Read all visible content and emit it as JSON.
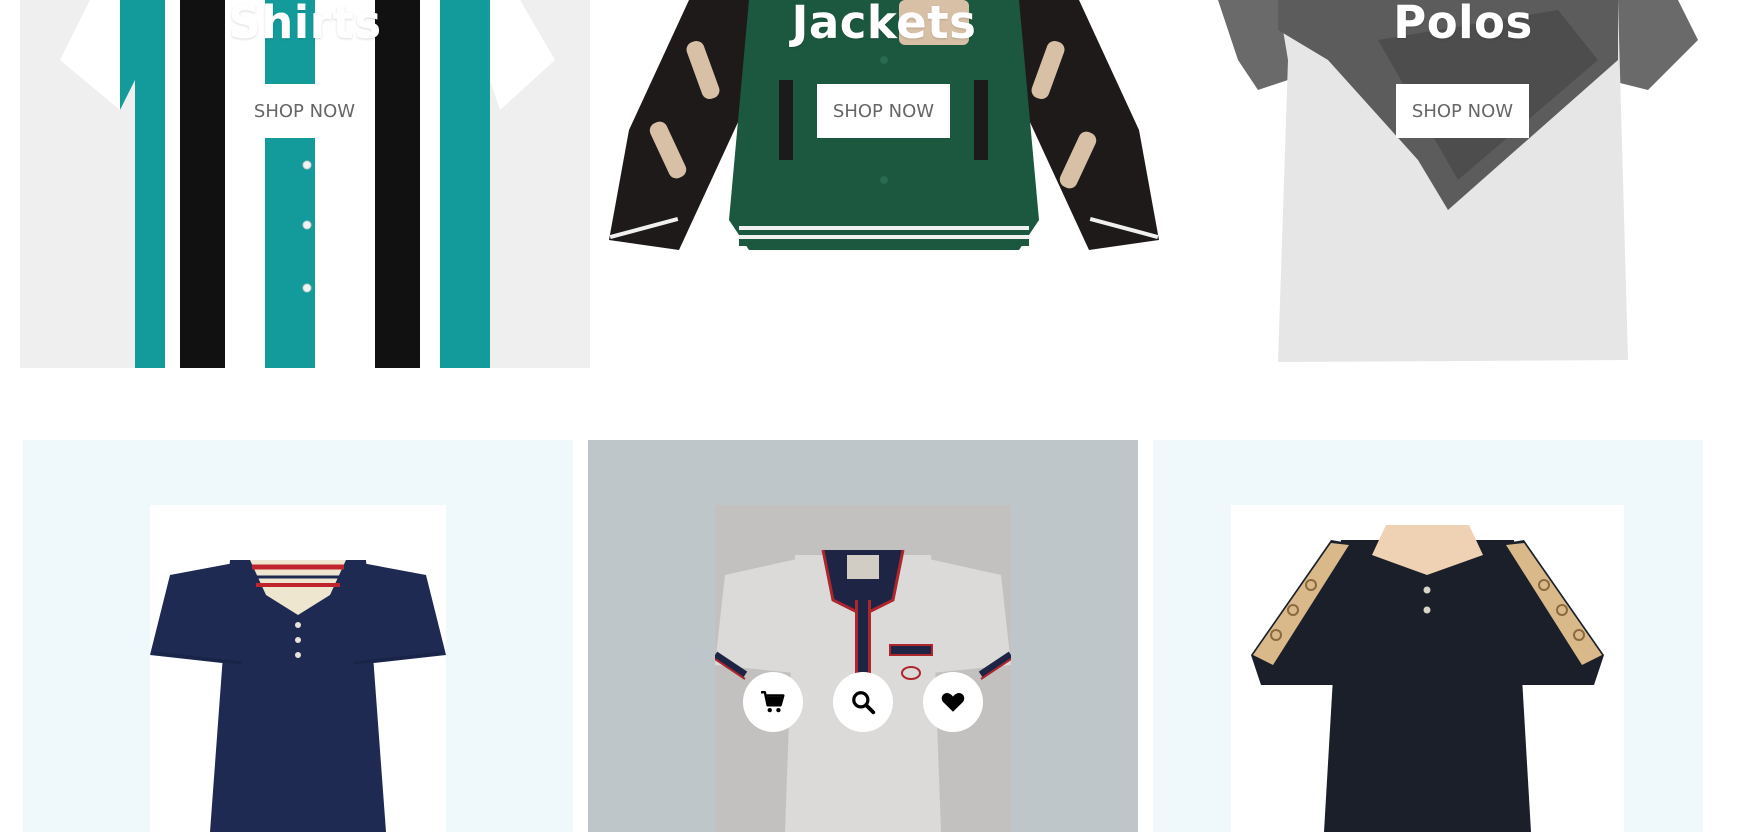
{
  "categories": [
    {
      "title": "Shirts",
      "button": "SHOP NOW"
    },
    {
      "title": "Jackets",
      "button": "SHOP NOW"
    },
    {
      "title": "Polos",
      "button": "SHOP NOW"
    }
  ],
  "products": [
    {
      "image": "navy-gg-polo"
    },
    {
      "image": "white-polo-navy-collar"
    },
    {
      "image": "black-polo-beige-collar"
    }
  ],
  "card_actions": [
    "cart-icon",
    "search-icon",
    "heart-icon"
  ],
  "colors": {
    "banner_text": "#ffffff",
    "button_text": "#666666",
    "card_bg": "#eff8fb",
    "card_hover_bg": "#bfc6c9"
  }
}
